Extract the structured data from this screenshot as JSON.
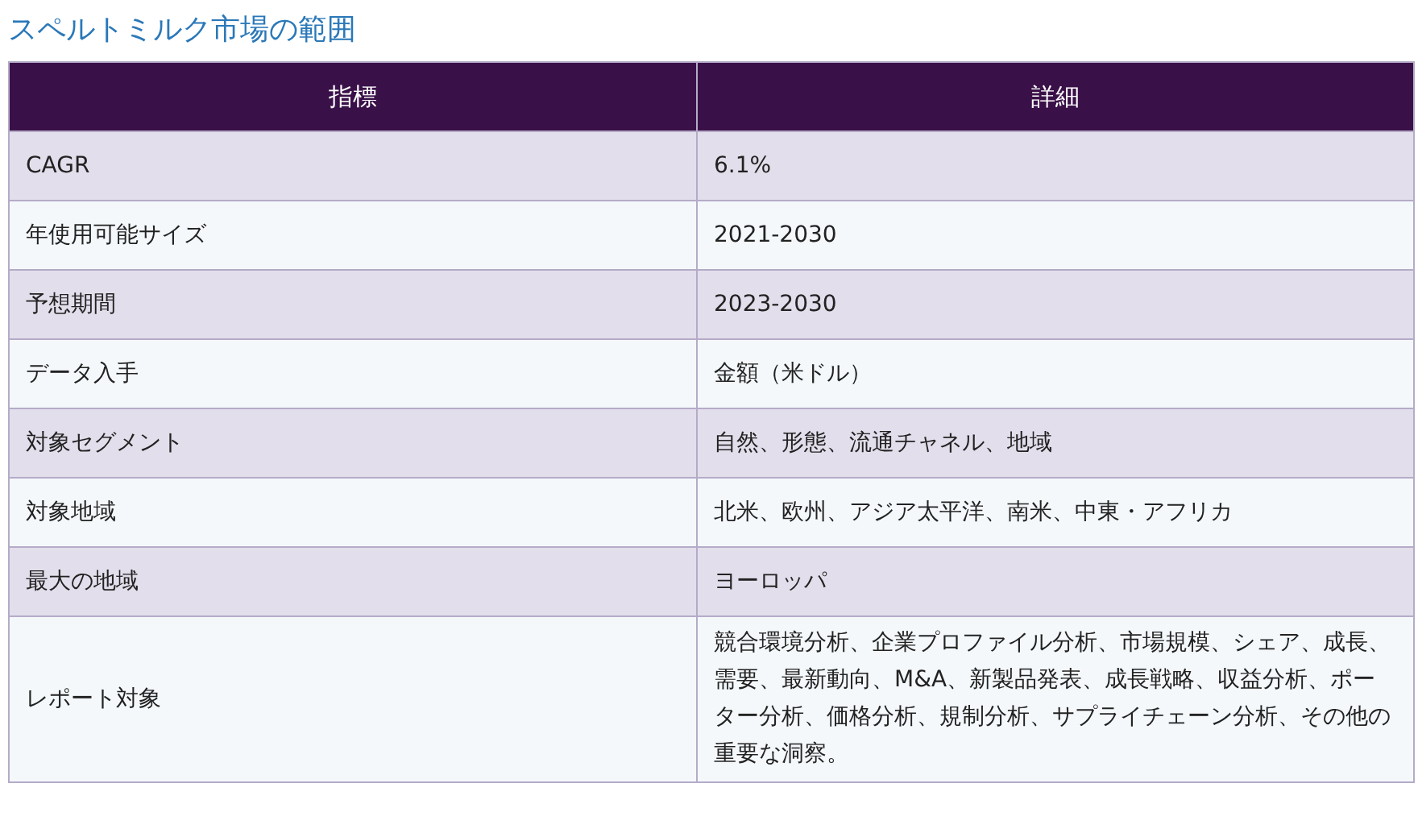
{
  "title": "スペルトミルク市場の範囲",
  "table": {
    "columns": [
      "指標",
      "詳細"
    ],
    "rows": [
      {
        "cells": [
          "CAGR",
          "6.1%"
        ]
      },
      {
        "cells": [
          "年使用可能サイズ",
          "2021-2030"
        ]
      },
      {
        "cells": [
          "予想期間",
          "2023-2030"
        ]
      },
      {
        "cells": [
          "データ入手",
          "金額（米ドル）"
        ]
      },
      {
        "cells": [
          "対象セグメント",
          "自然、形態、流通チャネル、地域"
        ]
      },
      {
        "cells": [
          "対象地域",
          "北米、欧州、アジア太平洋、南米、中東・アフリカ"
        ]
      },
      {
        "cells": [
          "最大の地域",
          "ヨーロッパ"
        ]
      },
      {
        "cells": [
          "レポート対象",
          "競合環境分析、企業プロファイル分析、市場規模、シェア、成長、需要、最新動向、M&A、新製品発表、成長戦略、収益分析、ポーター分析、価格分析、規制分析、サプライチェーン分析、その他の重要な洞察。"
        ]
      }
    ]
  }
}
